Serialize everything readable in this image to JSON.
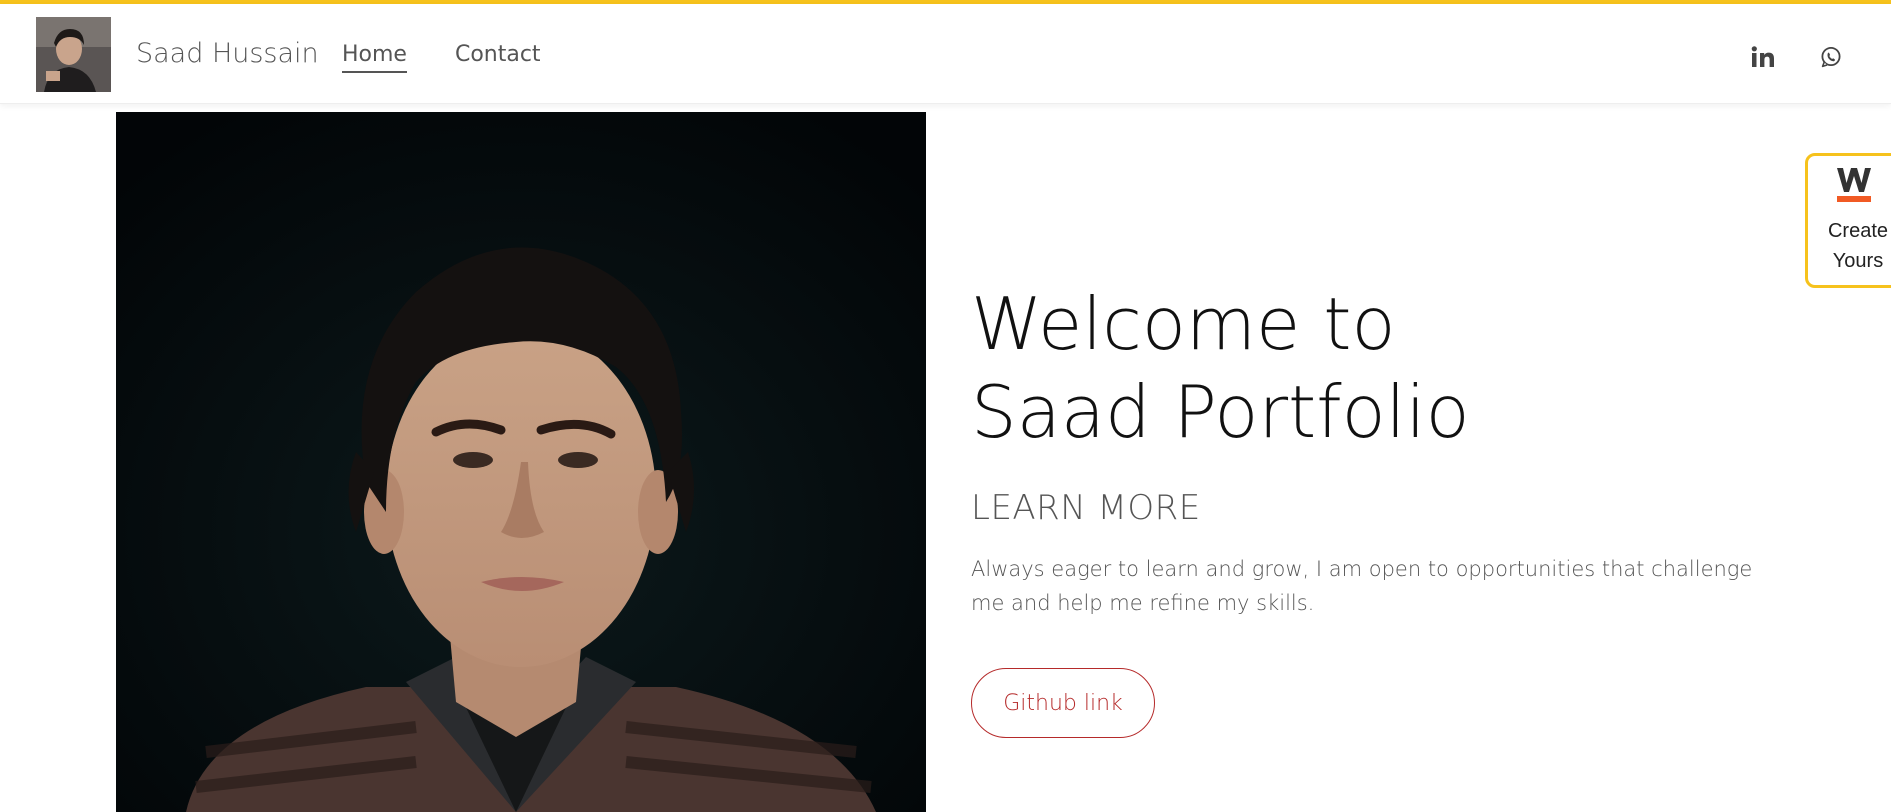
{
  "header": {
    "site_name": "Saad Hussain",
    "nav": [
      {
        "label": "Home",
        "active": true
      },
      {
        "label": "Contact",
        "active": false
      }
    ],
    "social": [
      {
        "icon": "linkedin-icon"
      },
      {
        "icon": "whatsapp-icon"
      }
    ]
  },
  "hero": {
    "title": "Welcome to Saad Portfolio",
    "subtitle": "LEARN MORE",
    "description": "Always eager to learn and grow, I am open to opportunities that challenge me and help me refine my skills.",
    "button_label": "Github link"
  },
  "widget": {
    "label_line1": "Create",
    "label_line2": "Yours",
    "logo_letter": "W"
  },
  "colors": {
    "accent": "#f6c21c",
    "button": "#b52a2a",
    "widget_logo_bar": "#f15a24"
  }
}
